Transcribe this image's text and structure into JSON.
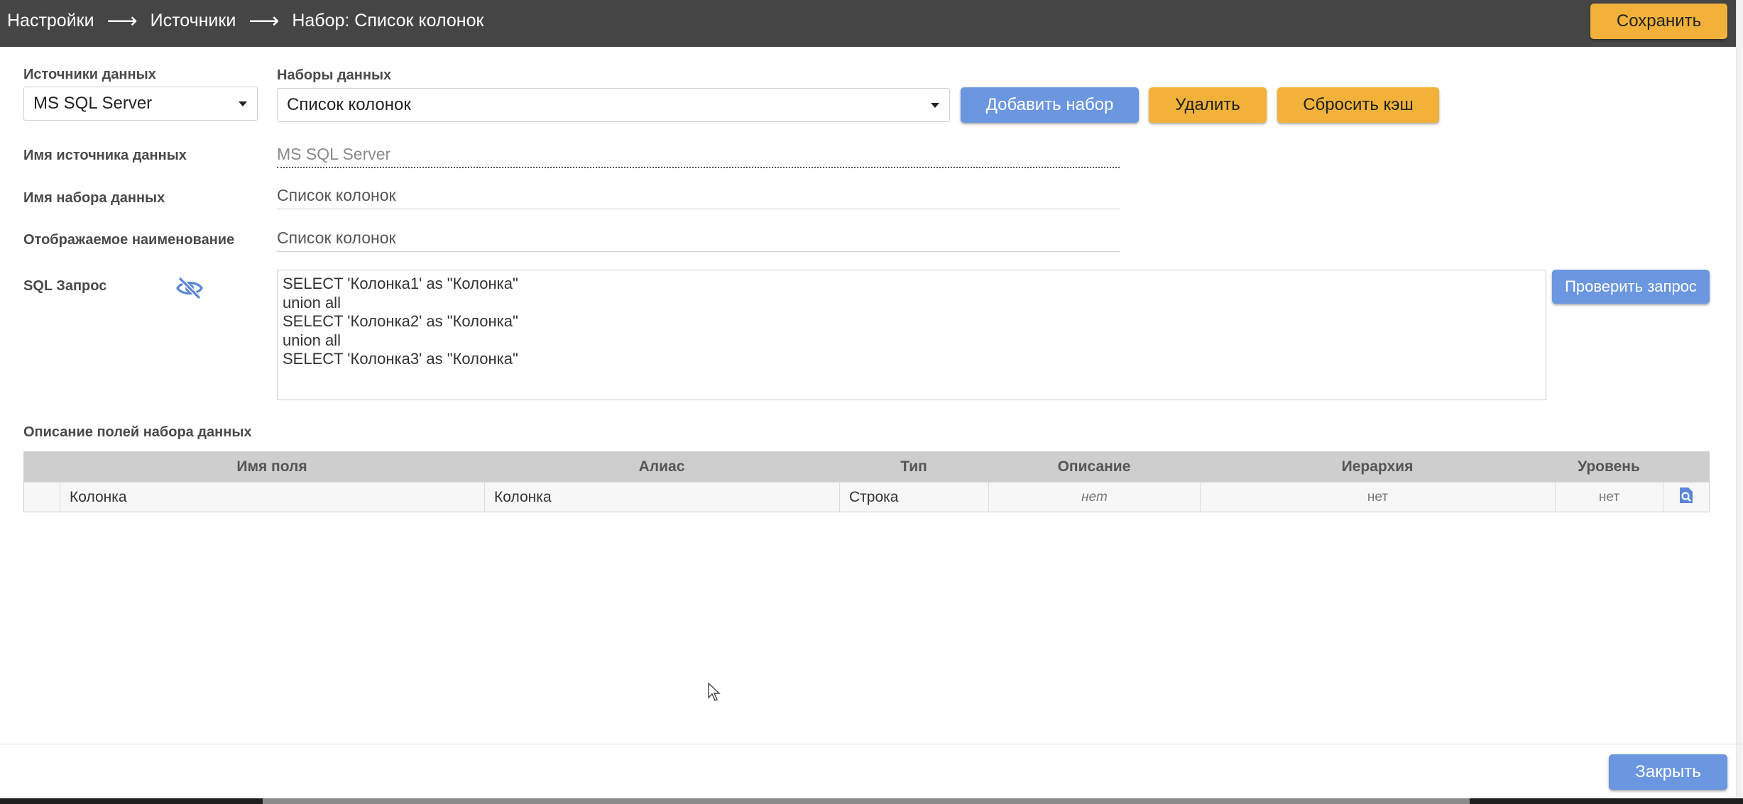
{
  "header": {
    "breadcrumbs": [
      "Настройки",
      "Источники",
      "Набор: Список колонок"
    ],
    "separator": "⟶",
    "save_label": "Сохранить"
  },
  "sources": {
    "label": "Источники данных",
    "selected": "MS SQL Server"
  },
  "datasets": {
    "label": "Наборы данных",
    "selected": "Список колонок",
    "add_label": "Добавить набор",
    "delete_label": "Удалить",
    "reset_cache_label": "Сбросить кэш"
  },
  "form": {
    "source_name_label": "Имя источника данных",
    "source_name_value": "MS SQL Server",
    "dataset_name_label": "Имя набора данных",
    "dataset_name_value": "Список колонок",
    "display_name_label": "Отображаемое наименование",
    "display_name_value": "Список колонок",
    "sql_label": "SQL Запрос",
    "sql_lines": [
      "SELECT 'Колонка1' as \"Колонка\"",
      "union all",
      "SELECT 'Колонка2' as \"Колонка\"",
      "union all",
      "SELECT 'Колонка3' as \"Колонка\""
    ],
    "check_query_label": "Проверить запрос"
  },
  "fields_table": {
    "title": "Описание полей набора данных",
    "columns": [
      "Имя поля",
      "Алиас",
      "Тип",
      "Описание",
      "Иерархия",
      "Уровень"
    ],
    "rows": [
      {
        "name": "Колонка",
        "alias": "Колонка",
        "type": "Строка",
        "description": "нет",
        "hierarchy": "нет",
        "level": "нет"
      }
    ]
  },
  "footer": {
    "close_label": "Закрыть"
  },
  "colors": {
    "header_bg": "#454545",
    "orange": "#f2b23a",
    "blue": "#6b96e0"
  }
}
